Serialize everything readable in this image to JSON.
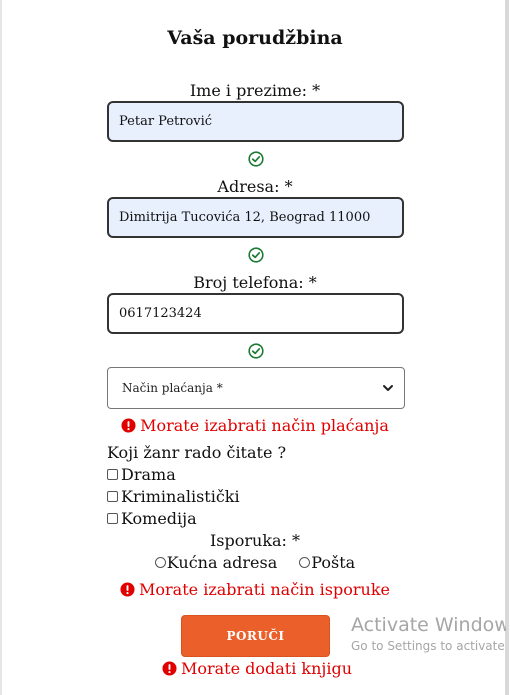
{
  "form": {
    "title": "Vaša porudžbina",
    "name_label": "Ime i prezime: *",
    "name_value": "Petar Petrović",
    "address_label": "Adresa: *",
    "address_value": "Dimitrija Tucovića 12, Beograd 11000",
    "phone_label": "Broj telefona: *",
    "phone_value": "0617123424",
    "payment_select_value": "Način plaćanja *",
    "payment_error": "Morate izabrati način plaćanja",
    "genre_question": "Koji žanr rado čitate ?",
    "genres": [
      "Drama",
      "Kriminalistički",
      "Komedija"
    ],
    "delivery_label": "Isporuka: *",
    "delivery_options": [
      "Kućna adresa",
      "Pošta"
    ],
    "delivery_error": "Morate izabrati način isporuke",
    "submit_label": "PORUČI",
    "submit_error": "Morate dodati knjigu"
  },
  "colors": {
    "error": "#e00000",
    "valid": "#1e7a35",
    "button": "#eb5f2a",
    "autofill": "#e8f0fe"
  },
  "watermark": {
    "title": "Activate Windows",
    "subtitle": "Go to Settings to activate Windows."
  }
}
